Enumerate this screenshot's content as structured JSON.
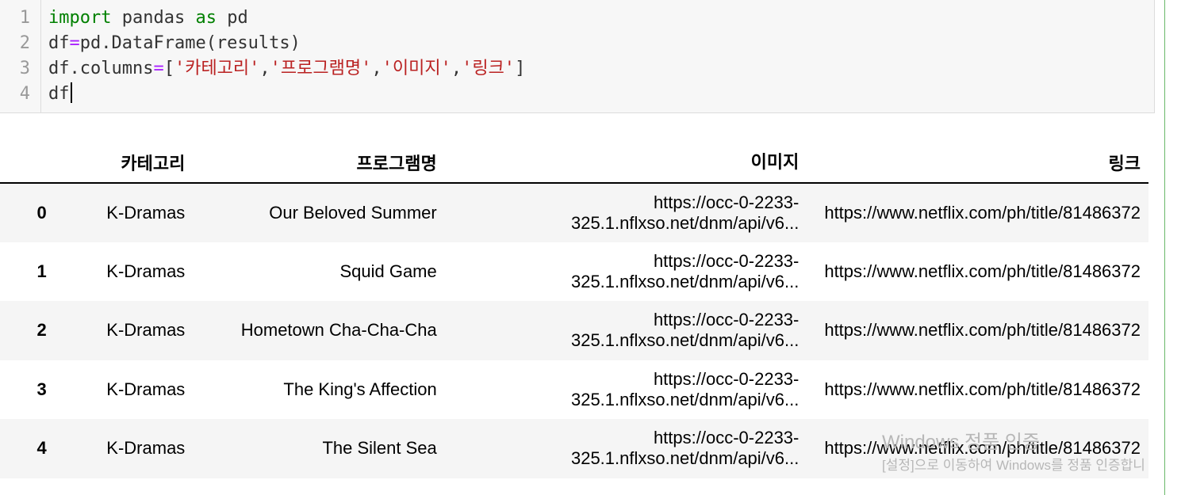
{
  "code": {
    "line_numbers": [
      "1",
      "2",
      "3",
      "4"
    ],
    "line1": {
      "kw_import": "import",
      "t1": " pandas ",
      "kw_as": "as",
      "t2": " pd"
    },
    "line2": {
      "a": "df",
      "eq": "=",
      "b": "pd.DataFrame(results)"
    },
    "line3": {
      "a": "df.columns",
      "eq": "=",
      "open": "[",
      "s1": "'카테고리'",
      "c1": ",",
      "s2": "'프로그램명'",
      "c2": ",",
      "s3": "'이미지'",
      "c3": ",",
      "s4": "'링크'",
      "close": "]"
    },
    "line4": {
      "a": "df"
    }
  },
  "table": {
    "columns": [
      "",
      "카테고리",
      "프로그램명",
      "이미지",
      "링크"
    ],
    "rows": [
      {
        "index": "0",
        "category": "K-Dramas",
        "program": "Our Beloved Summer",
        "image_l1": "https://occ-0-2233-",
        "image_l2": "325.1.nflxso.net/dnm/api/v6...",
        "link": "https://www.netflix.com/ph/title/81486372"
      },
      {
        "index": "1",
        "category": "K-Dramas",
        "program": "Squid Game",
        "image_l1": "https://occ-0-2233-",
        "image_l2": "325.1.nflxso.net/dnm/api/v6...",
        "link": "https://www.netflix.com/ph/title/81486372"
      },
      {
        "index": "2",
        "category": "K-Dramas",
        "program": "Hometown Cha-Cha-Cha",
        "image_l1": "https://occ-0-2233-",
        "image_l2": "325.1.nflxso.net/dnm/api/v6...",
        "link": "https://www.netflix.com/ph/title/81486372"
      },
      {
        "index": "3",
        "category": "K-Dramas",
        "program": "The King's Affection",
        "image_l1": "https://occ-0-2233-",
        "image_l2": "325.1.nflxso.net/dnm/api/v6...",
        "link": "https://www.netflix.com/ph/title/81486372"
      },
      {
        "index": "4",
        "category": "K-Dramas",
        "program": "The Silent Sea",
        "image_l1": "https://occ-0-2233-",
        "image_l2": "325.1.nflxso.net/dnm/api/v6...",
        "link": "https://www.netflix.com/ph/title/81486372"
      }
    ]
  },
  "watermark": {
    "title": "Windows 정품 인증",
    "subtitle": "[설정]으로 이동하여 Windows를 정품 인증합니"
  },
  "colors": {
    "keyword": "#008000",
    "operator": "#aa22ff",
    "string": "#ba2121",
    "cell_border": "#6ab96a"
  }
}
